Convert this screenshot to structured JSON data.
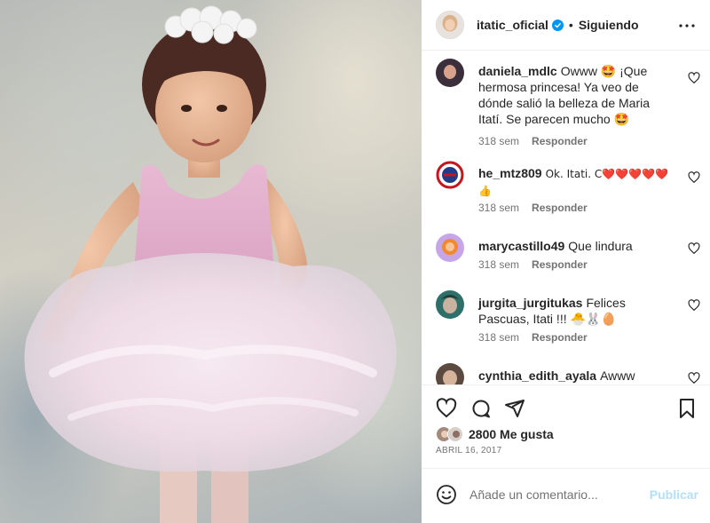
{
  "post": {
    "image_alt": "Childhood photo of a girl in a pink ballet tutu and a flower crown"
  },
  "header": {
    "username": "itatic_oficial",
    "verified": true,
    "separator": "•",
    "follow_status": "Siguiendo",
    "more_icon": "more-horizontal-icon"
  },
  "comments": [
    {
      "username": "daniela_mdlc",
      "text": "Owww 🤩 ¡Que hermosa princesa! Ya veo de dónde salió la belleza de Maria Itatí. Se parecen mucho 🤩",
      "age": "318 sem",
      "reply_label": "Responder"
    },
    {
      "username": "he_mtz809",
      "text": "Ok. Itati. C❤️❤️❤️❤️❤️👍",
      "age": "318 sem",
      "reply_label": "Responder"
    },
    {
      "username": "marycastillo49",
      "text": "Que lindura",
      "age": "318 sem",
      "reply_label": "Responder"
    },
    {
      "username": "jurgita_jurgitukas",
      "text": "Felices Pascuas, Itati !!! 🐣🐰🥚",
      "age": "318 sem",
      "reply_label": "Responder"
    },
    {
      "username": "cynthia_edith_ayala",
      "text": "Awww siempre",
      "age": "",
      "reply_label": ""
    }
  ],
  "actions": {
    "like_icon": "heart-icon",
    "comment_icon": "comment-icon",
    "share_icon": "share-icon",
    "save_icon": "bookmark-icon"
  },
  "likes": {
    "count_label": "2800 Me gusta"
  },
  "date": "ABRIL 16, 2017",
  "add_comment": {
    "emoji_icon": "emoji-icon",
    "placeholder": "Añade un comentario...",
    "publish_label": "Publicar"
  },
  "colors": {
    "accent": "#0095f6",
    "publish_disabled": "#b2dffc",
    "text_secondary": "#737373",
    "like_heart": "#ed4956"
  }
}
